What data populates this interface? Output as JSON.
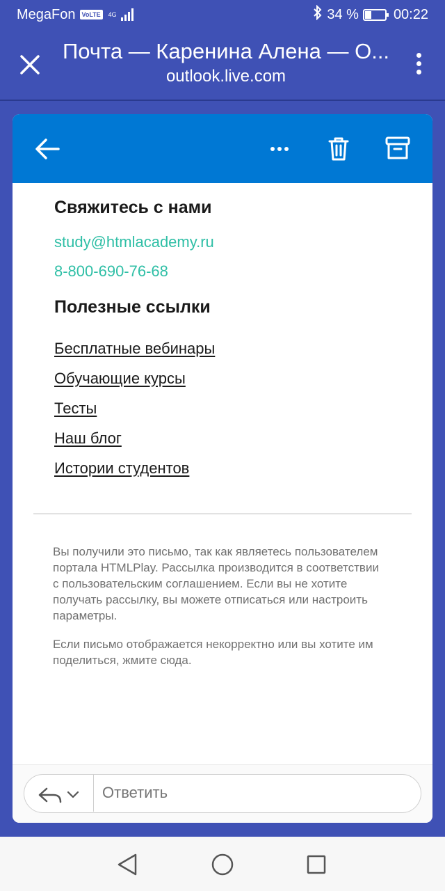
{
  "status_bar": {
    "carrier": "MegaFon",
    "volte": "VoLTE",
    "network": "4G",
    "battery_percent": "34 %",
    "battery_level": 0.34,
    "time": "00:22"
  },
  "browser": {
    "title": "Почта — Каренина Алена — O...",
    "url": "outlook.live.com"
  },
  "mail": {
    "contact_heading": "Свяжитесь с нами",
    "email": "study@htmlacademy.ru",
    "phone": "8-800-690-76-68",
    "links_heading": "Полезные ссылки",
    "links": [
      "Бесплатные вебинары",
      "Обучающие курсы",
      "Тесты",
      "Наш блог",
      "Истории студентов"
    ],
    "footer_1": "Вы получили это письмо, так как являетесь пользователем портала HTMLPlay. Рассылка производится в соответствии с пользовательским соглашением. Если вы не хотите получать рассылку, вы можете отписаться или настроить параметры.",
    "footer_2": "Если письмо отображается некорректно или вы хотите им поделиться, жмите сюда."
  },
  "reply": {
    "placeholder": "Ответить"
  },
  "colors": {
    "browser_bar": "#3f51b5",
    "mail_toolbar": "#0078d4",
    "link_accent": "#2fbfa6"
  }
}
